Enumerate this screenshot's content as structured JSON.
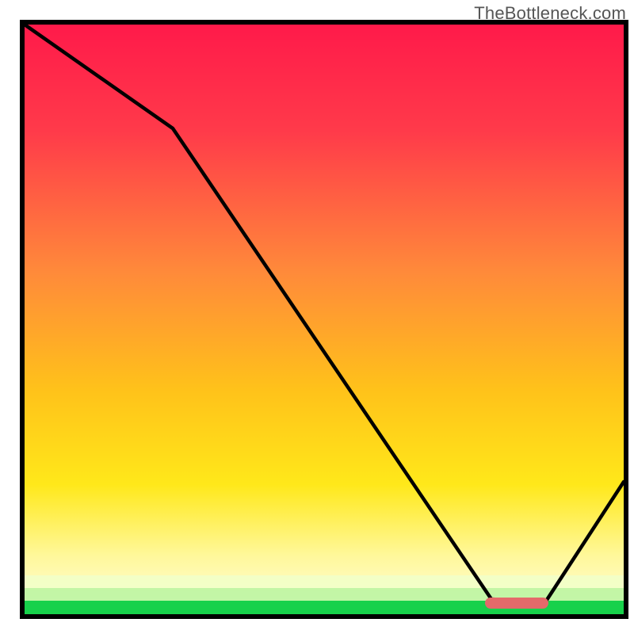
{
  "watermark": "TheBottleneck.com",
  "chart_data": {
    "type": "line",
    "title": "",
    "xlabel": "",
    "ylabel": "",
    "xlim": [
      0,
      100
    ],
    "ylim": [
      0,
      100
    ],
    "curve": {
      "x": [
        0,
        25,
        78,
        87,
        100
      ],
      "y_pct": [
        100,
        82,
        3,
        2,
        23
      ]
    },
    "optimal_range_x": [
      77,
      88
    ],
    "background_gradient_stops": [
      {
        "pos": 0.0,
        "color": "#ff1a4a"
      },
      {
        "pos": 0.42,
        "color": "#ff8a3a"
      },
      {
        "pos": 0.78,
        "color": "#ffe81a"
      },
      {
        "pos": 0.95,
        "color": "#b8f5a0"
      },
      {
        "pos": 1.0,
        "color": "#17d14b"
      }
    ]
  }
}
